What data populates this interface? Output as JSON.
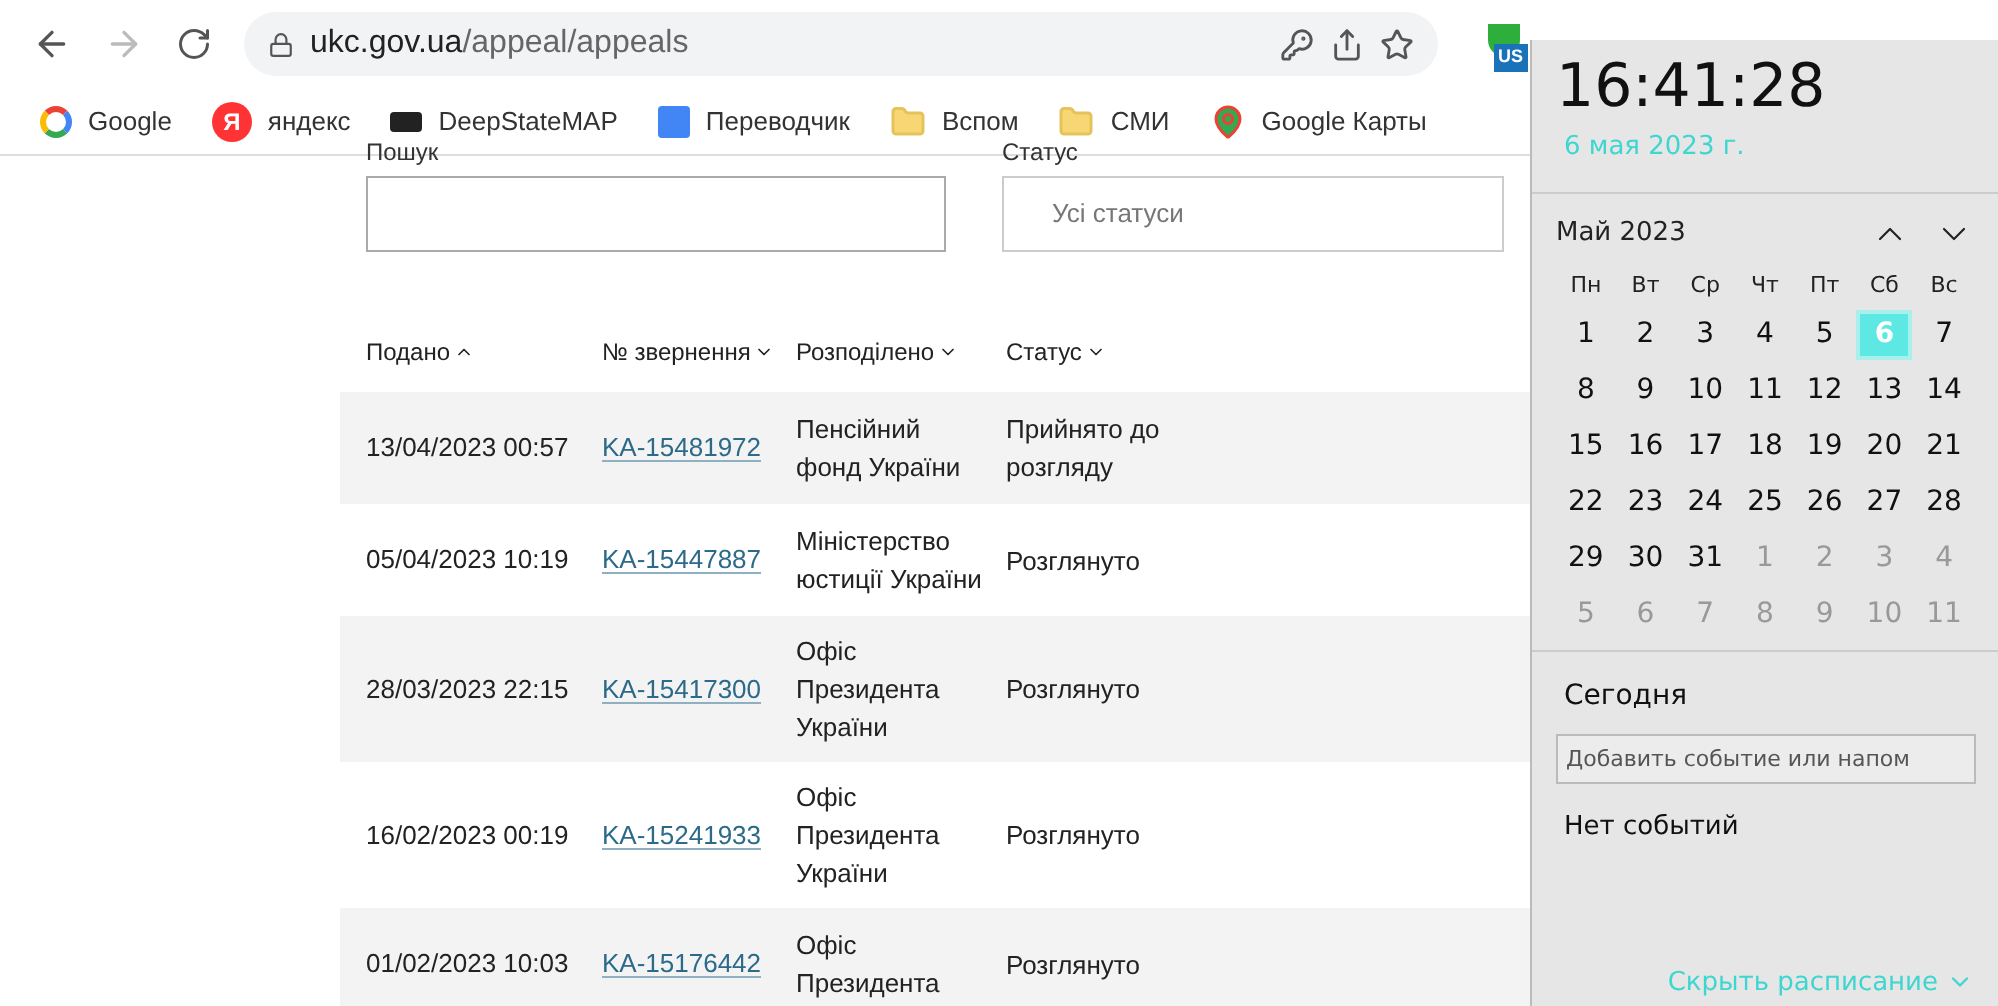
{
  "browser": {
    "url_host": "ukc.gov.ua",
    "url_path": "/appeal/appeals",
    "extension_badge": "US"
  },
  "bookmarks": [
    {
      "kind": "google",
      "label": "Google"
    },
    {
      "kind": "yandex",
      "label": "яндекс",
      "icon_text": "Я"
    },
    {
      "kind": "map",
      "label": "DeepStateMAP"
    },
    {
      "kind": "translate",
      "label": "Переводчик"
    },
    {
      "kind": "folder",
      "label": "Вспом"
    },
    {
      "kind": "folder",
      "label": "СМИ"
    },
    {
      "kind": "maps",
      "label": "Google Карты"
    }
  ],
  "filters": {
    "search_label": "Пошук",
    "status_label": "Статус",
    "status_value": "Усі статуси"
  },
  "table": {
    "columns": [
      {
        "label": "Подано",
        "sort_ascending": true
      },
      {
        "label": "№ звернення",
        "sort_ascending": false
      },
      {
        "label": "Розподілено",
        "sort_ascending": false
      },
      {
        "label": "Статус",
        "sort_ascending": false
      }
    ],
    "rows": [
      {
        "date": "13/04/2023 00:57",
        "number": "KA-15481972",
        "assigned": "Пенсійний фонд України",
        "status": "Прийнято до розгляду"
      },
      {
        "date": "05/04/2023 10:19",
        "number": "KA-15447887",
        "assigned": "Міністерство юстиції України",
        "status": "Розглянуто"
      },
      {
        "date": "28/03/2023 22:15",
        "number": "KA-15417300",
        "assigned": "Офіс Президента України",
        "status": "Розглянуто"
      },
      {
        "date": "16/02/2023 00:19",
        "number": "KA-15241933",
        "assigned": "Офіс Президента України",
        "status": "Розглянуто"
      },
      {
        "date": "01/02/2023 10:03",
        "number": "KA-15176442",
        "assigned": "Офіс Президента",
        "status": "Розглянуто"
      }
    ]
  },
  "clock": {
    "time": "16:41:28",
    "date": "6 мая 2023 г.",
    "month": "Май 2023",
    "weekdays": [
      "Пн",
      "Вт",
      "Ср",
      "Чт",
      "Пт",
      "Сб",
      "Вс"
    ],
    "days": [
      {
        "label": "1",
        "kind": "current",
        "selected": false
      },
      {
        "label": "2",
        "kind": "current",
        "selected": false
      },
      {
        "label": "3",
        "kind": "current",
        "selected": false
      },
      {
        "label": "4",
        "kind": "current",
        "selected": false
      },
      {
        "label": "5",
        "kind": "current",
        "selected": false
      },
      {
        "label": "6",
        "kind": "current",
        "selected": true
      },
      {
        "label": "7",
        "kind": "current",
        "selected": false
      },
      {
        "label": "8",
        "kind": "current",
        "selected": false
      },
      {
        "label": "9",
        "kind": "current",
        "selected": false
      },
      {
        "label": "10",
        "kind": "current",
        "selected": false
      },
      {
        "label": "11",
        "kind": "current",
        "selected": false
      },
      {
        "label": "12",
        "kind": "current",
        "selected": false
      },
      {
        "label": "13",
        "kind": "current",
        "selected": false
      },
      {
        "label": "14",
        "kind": "current",
        "selected": false
      },
      {
        "label": "15",
        "kind": "current",
        "selected": false
      },
      {
        "label": "16",
        "kind": "current",
        "selected": false
      },
      {
        "label": "17",
        "kind": "current",
        "selected": false
      },
      {
        "label": "18",
        "kind": "current",
        "selected": false
      },
      {
        "label": "19",
        "kind": "current",
        "selected": false
      },
      {
        "label": "20",
        "kind": "current",
        "selected": false
      },
      {
        "label": "21",
        "kind": "current",
        "selected": false
      },
      {
        "label": "22",
        "kind": "current",
        "selected": false
      },
      {
        "label": "23",
        "kind": "current",
        "selected": false
      },
      {
        "label": "24",
        "kind": "current",
        "selected": false
      },
      {
        "label": "25",
        "kind": "current",
        "selected": false
      },
      {
        "label": "26",
        "kind": "current",
        "selected": false
      },
      {
        "label": "27",
        "kind": "current",
        "selected": false
      },
      {
        "label": "28",
        "kind": "current",
        "selected": false
      },
      {
        "label": "29",
        "kind": "current",
        "selected": false
      },
      {
        "label": "30",
        "kind": "current",
        "selected": false
      },
      {
        "label": "31",
        "kind": "current",
        "selected": false
      },
      {
        "label": "1",
        "kind": "other",
        "selected": false
      },
      {
        "label": "2",
        "kind": "other",
        "selected": false
      },
      {
        "label": "3",
        "kind": "other",
        "selected": false
      },
      {
        "label": "4",
        "kind": "other",
        "selected": false
      },
      {
        "label": "5",
        "kind": "other",
        "selected": false
      },
      {
        "label": "6",
        "kind": "other",
        "selected": false
      },
      {
        "label": "7",
        "kind": "other",
        "selected": false
      },
      {
        "label": "8",
        "kind": "other",
        "selected": false
      },
      {
        "label": "9",
        "kind": "other",
        "selected": false
      },
      {
        "label": "10",
        "kind": "other",
        "selected": false
      },
      {
        "label": "11",
        "kind": "other",
        "selected": false
      }
    ],
    "today_heading": "Сегодня",
    "event_value": "Добавить событие или напом",
    "no_events": "Нет событий",
    "hide_link": "Скрыть расписание"
  }
}
